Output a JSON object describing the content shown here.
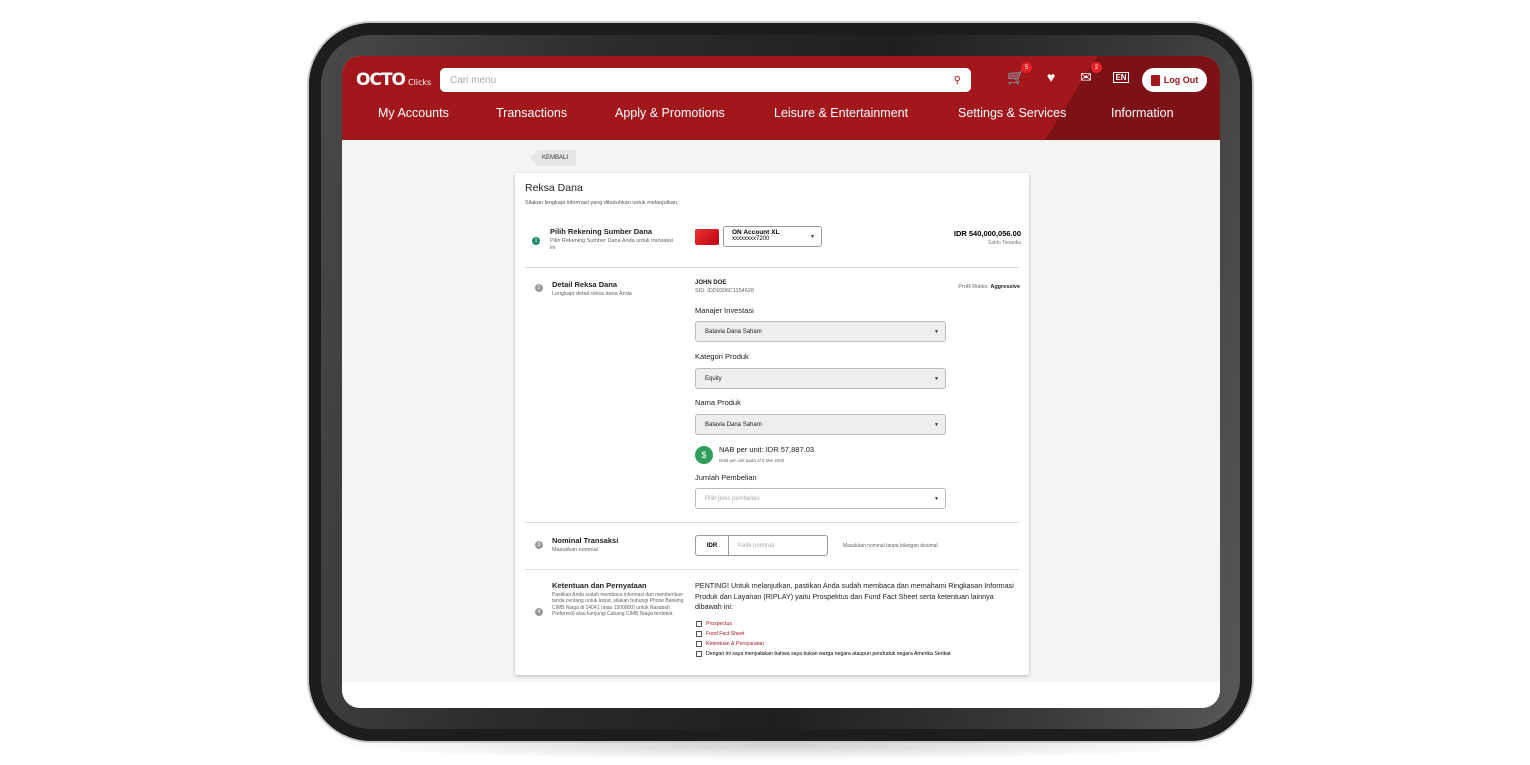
{
  "app": {
    "logo_text": "OCTO",
    "logo_sub": "Clicks",
    "search_placeholder": "Cari menu",
    "cart_count": "5",
    "mail_count": "2",
    "language": "EN",
    "logout_label": "Log Out"
  },
  "nav": {
    "items": [
      "My Accounts",
      "Transactions",
      "Apply & Promotions",
      "Leisure & Entertainment",
      "Settings & Services",
      "Information"
    ]
  },
  "page": {
    "back_label": "KEMBALI",
    "title": "Reksa Dana",
    "subtitle": "Silakan lengkapi informasi yang dibutuhkan untuk melanjutkan."
  },
  "step1": {
    "num": "1",
    "title": "Pilih Rekening Sumber Dana",
    "desc": "Pilih Rekening Sumber Dana Anda untuk transaksi ini",
    "account_name": "ON Account XL",
    "account_number": "xxxxxxxx7200",
    "balance": "IDR 540,000,056.00",
    "balance_label": "Saldo Tersedia"
  },
  "step2": {
    "num": "2",
    "title": "Detail Reksa Dana",
    "desc": "Lengkapi detail reksa dana Anda",
    "customer_name": "JOHN DOE",
    "sid": "SID: IDD0306C1154628",
    "risk_label": "Profil Risiko:",
    "risk_value": "Aggressive",
    "manager_label": "Manajer Investasi",
    "manager_value": "Batavia Dana Saham",
    "category_label": "Kategori Produk",
    "category_value": "Equity",
    "product_label": "Nama Produk",
    "product_value": "Batavia Dana Saham",
    "nab_text": "NAB per unit: IDR 57,887.03",
    "nab_date": "NAB per unit pada of 5 Mei 2020",
    "purchase_label": "Jumlah Pembelian",
    "purchase_placeholder": "Pilih jenis pembelian"
  },
  "step3": {
    "num": "3",
    "title": "Nominal Transaksi",
    "desc": "Masukkan nominal",
    "currency": "IDR",
    "amount_placeholder": "Ketik nominal",
    "hint": "Masukkan nominal tanpa bilangan desimal"
  },
  "step4": {
    "num": "4",
    "title": "Ketentuan dan Pernyataan",
    "desc": "Pastikan Anda sudah membaca informasi dan memberikan tanda centang untuk lanjut, silakan hubungi Phone Banking CIMB Niaga di 14041 (atau 1500800) untuk Nasabah Preferred) atau kunjungi Cabang CIMB Niaga terdekat.",
    "notice": "PENTING! Untuk melanjutkan, pastikan Anda sudah membaca dan memahami Ringkasan Informasi Produk dan Layanan (RIPLAY) yaitu Prospektus dan Fund Fact Sheet serta ketentuan lainnya dibawah ini:",
    "checkboxes": [
      "Prospectus",
      "Fund Fact Sheet",
      "Ketentuan & Persyaratan",
      "Dengan ini saya menyatakan bahwa saya bukan warga negara ataupun penduduk negara Amerika Serikat"
    ]
  },
  "colors": {
    "brand": "#a1171c",
    "brand_dark": "#7c1216",
    "success": "#1d8c5e"
  }
}
